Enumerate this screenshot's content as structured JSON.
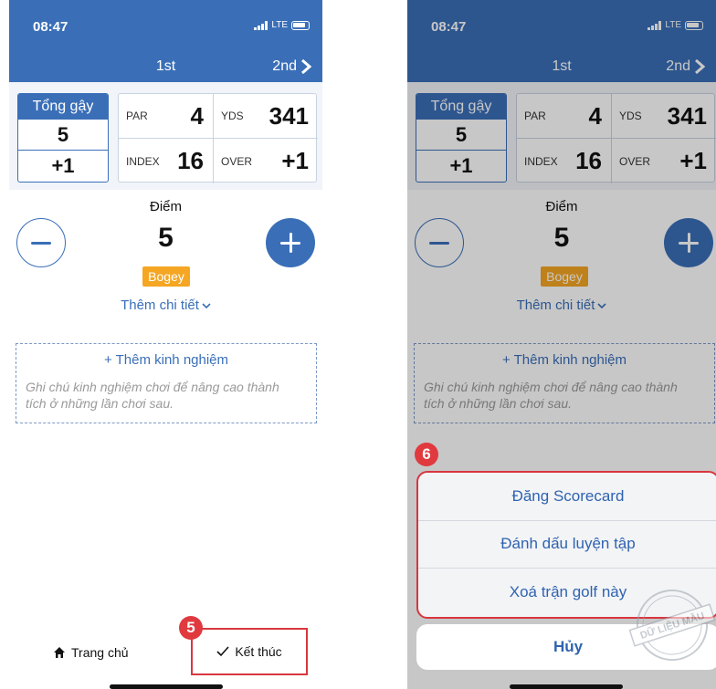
{
  "colors": {
    "primary": "#3a6fb8",
    "badge": "#f5a623",
    "highlight": "#d9363e",
    "step_marker": "#e0393e"
  },
  "status": {
    "time": "08:47",
    "network": "LTE"
  },
  "nav": {
    "title": "1st",
    "next": "2nd"
  },
  "strokes": {
    "label": "Tổng gậy",
    "value": "5",
    "over": "+1"
  },
  "hole_info": {
    "par_label": "PAR",
    "par_value": "4",
    "yds_label": "YDS",
    "yds_value": "341",
    "index_label": "INDEX",
    "index_value": "16",
    "over_label": "OVER",
    "over_value": "+1"
  },
  "score": {
    "label": "Điểm",
    "value": "5",
    "badge": "Bogey",
    "more": "Thêm chi tiết"
  },
  "experience": {
    "title": "+ Thêm kinh nghiệm",
    "note": "Ghi chú kinh nghiệm chơi để nâng cao thành tích ở những lần chơi sau."
  },
  "tabbar": {
    "home": "Trang chủ",
    "finish": "Kết thúc"
  },
  "steps": {
    "left": "5",
    "right": "6"
  },
  "action_sheet": {
    "options": [
      "Đăng Scorecard",
      "Đánh dấu luyện tập",
      "Xoá trận golf này"
    ],
    "cancel": "Hủy"
  },
  "watermark": "DỮ LIỆU MẪU"
}
